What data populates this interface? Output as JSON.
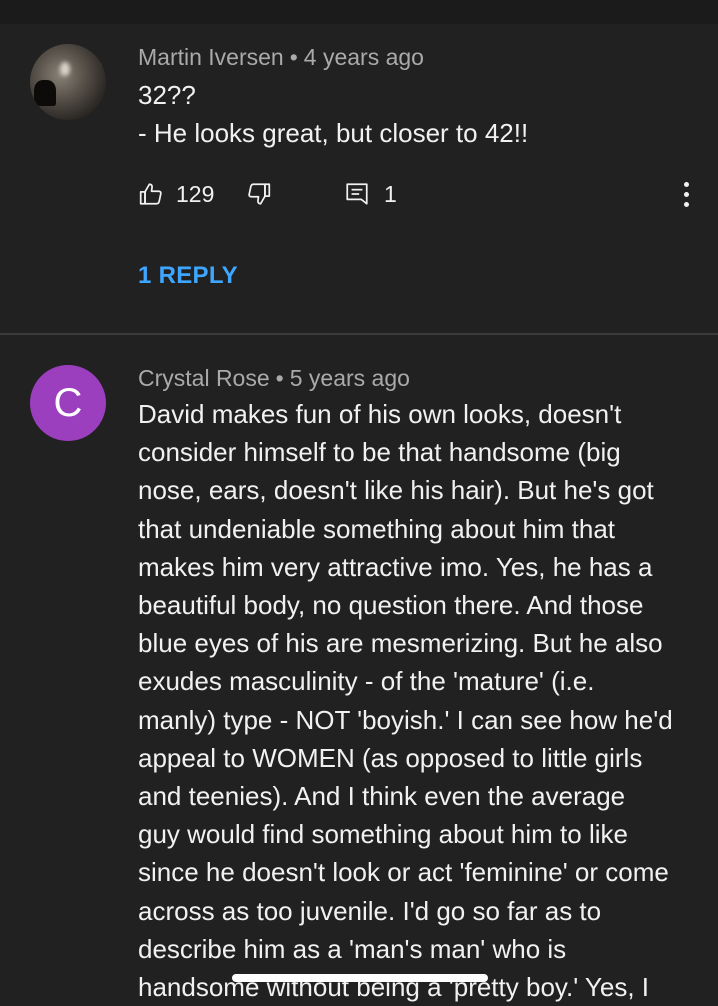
{
  "comments": [
    {
      "author": "Martin Iversen",
      "separator": "•",
      "time": "4 years ago",
      "lines": [
        "32??",
        "- He looks great, but closer to 42!!"
      ],
      "likes": "129",
      "reply_count": "1",
      "replies_label": "1 REPLY",
      "avatar": "photo"
    },
    {
      "author": "Crystal Rose",
      "separator": "•",
      "time": "5 years ago",
      "avatar": "letter",
      "avatar_letter": "C",
      "avatar_color": "#9b3fbf",
      "lines": [
        "David makes fun of his own looks, doesn't",
        "consider himself to be that handsome (big",
        "nose, ears, doesn't like his hair).  But he's got",
        "that undeniable something about him that",
        "makes him very attractive imo.  Yes, he has a",
        "beautiful body, no question there.  And those",
        "blue eyes of his are mesmerizing.  But he also",
        "exudes masculinity - of the 'mature' (i.e.",
        "manly) type - NOT 'boyish.'  I can see how he'd",
        "appeal to WOMEN (as opposed to little girls",
        "and teenies).  And I think even the average",
        "guy would find something about him to like",
        "since he doesn't look or act 'feminine' or come",
        "across as too juvenile.  I'd go so far as to",
        "describe him as a 'man's man' who is",
        "handsome without being a 'pretty boy.'  Yes, I"
      ]
    }
  ],
  "icons": {
    "like": "thumbs-up-icon",
    "dislike": "thumbs-down-icon",
    "reply": "comment-icon",
    "more": "more-vertical-icon"
  },
  "colors": {
    "background": "#212121",
    "link": "#3ea6ff",
    "meta": "#aaaaaa",
    "text": "#f1f1f1"
  }
}
